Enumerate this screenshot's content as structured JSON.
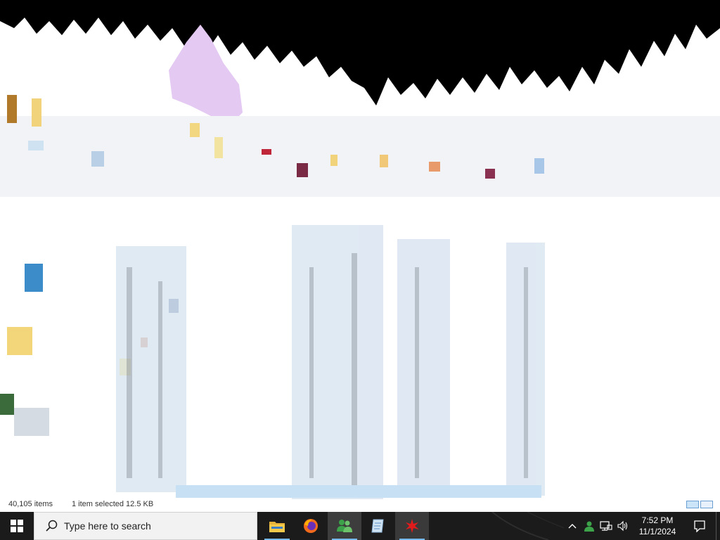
{
  "status_bar": {
    "item_count": "40,105 items",
    "selection": "1 item selected  12.5 KB"
  },
  "taskbar": {
    "search_placeholder": "Type here to search",
    "pinned": [
      {
        "name": "file-explorer",
        "icon": "folder-icon",
        "running": true
      },
      {
        "name": "firefox",
        "icon": "firefox-icon",
        "running": false
      },
      {
        "name": "users-app",
        "icon": "people-icon",
        "running": true
      },
      {
        "name": "notepad-app",
        "icon": "notepad-icon",
        "running": false
      },
      {
        "name": "red-app",
        "icon": "red-burst-icon",
        "running": true
      }
    ],
    "clock": {
      "time": "7:52 PM",
      "date": "11/1/2024"
    },
    "tray_icons": [
      "chevron-up-icon",
      "people-icon",
      "network-icon",
      "volume-icon"
    ]
  },
  "colors": {
    "taskbar_bg": "#1b1b1b",
    "accent": "#76b9ed",
    "window_bg": "#ffffff",
    "top_noise": "#000000"
  }
}
